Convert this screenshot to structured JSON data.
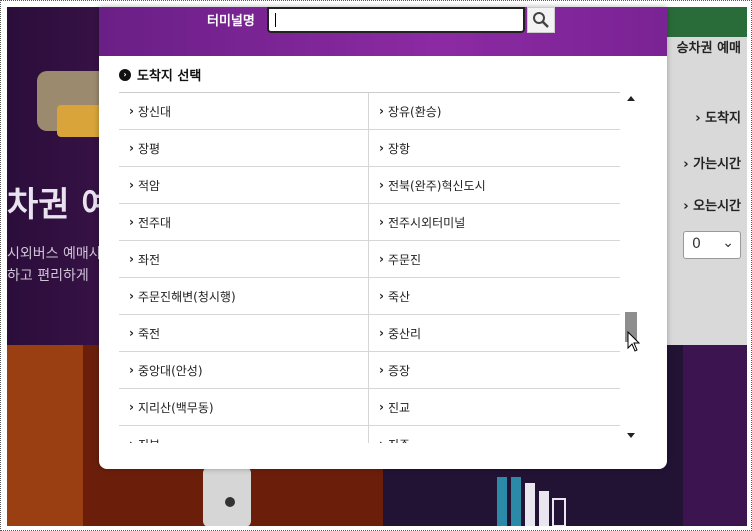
{
  "background": {
    "tabs": [
      "승차권 예매",
      "도착지",
      "가는시간",
      "오는시간"
    ],
    "select_value": "0",
    "hero_text": "차권 예",
    "sub_line1": "시외버스 예매사",
    "sub_line2": "하고 편리하게"
  },
  "modal": {
    "search_label": "터미널명",
    "search_value": "",
    "section_title": "도착지 선택",
    "rows": [
      [
        "장신대",
        "장유(환승)"
      ],
      [
        "장평",
        "장항"
      ],
      [
        "적암",
        "전북(완주)혁신도시"
      ],
      [
        "전주대",
        "전주시외터미널"
      ],
      [
        "좌전",
        "주문진"
      ],
      [
        "주문진해변(청시행)",
        "죽산"
      ],
      [
        "죽전",
        "중산리"
      ],
      [
        "중앙대(안성)",
        "증장"
      ],
      [
        "지리산(백무동)",
        "진교"
      ],
      [
        "진부",
        "진주"
      ]
    ]
  },
  "colors": {
    "header": "#7a2394",
    "accent": "#111111"
  }
}
